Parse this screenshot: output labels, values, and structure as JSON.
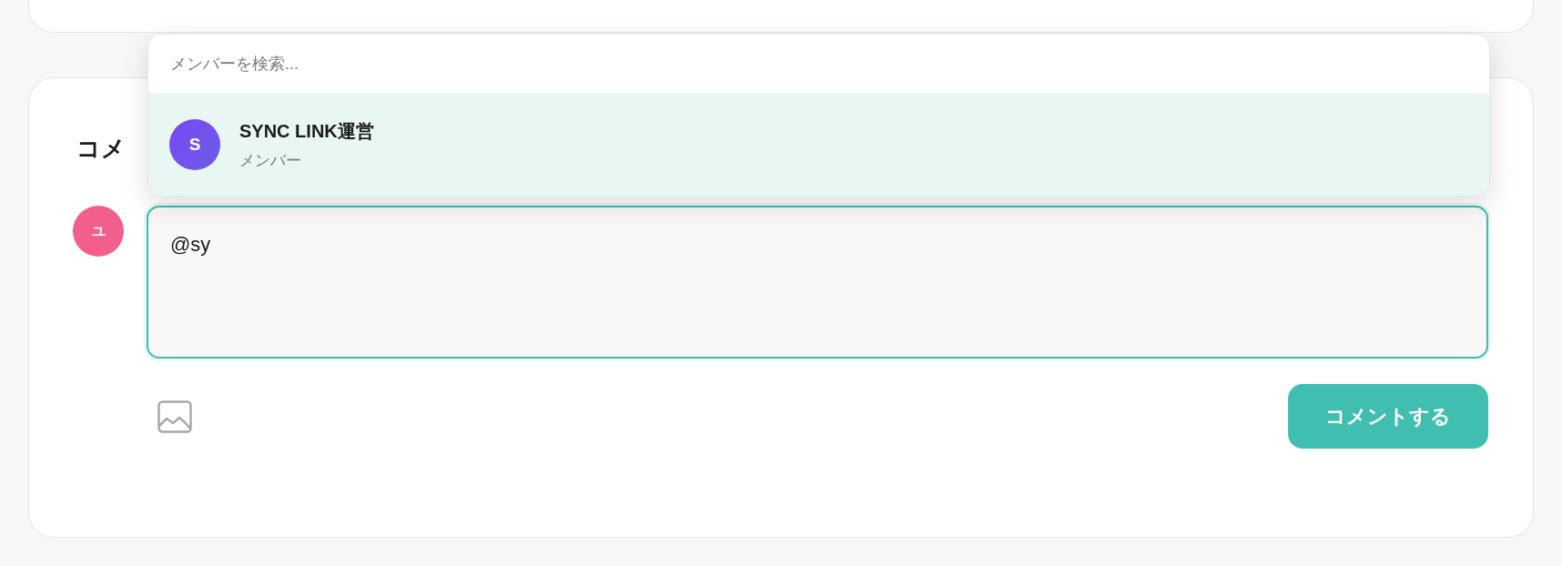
{
  "comment_section": {
    "heading": "コメ",
    "user_avatar": {
      "initial": "ユ"
    },
    "comment_field": {
      "value": "@sy"
    },
    "submit_button": {
      "label": "コメントする"
    }
  },
  "mention_dropdown": {
    "search": {
      "placeholder": "メンバーを検索..."
    },
    "members": [
      {
        "initial": "S",
        "name": "SYNC LINK運営",
        "role": "メンバー",
        "selected": true
      }
    ]
  }
}
